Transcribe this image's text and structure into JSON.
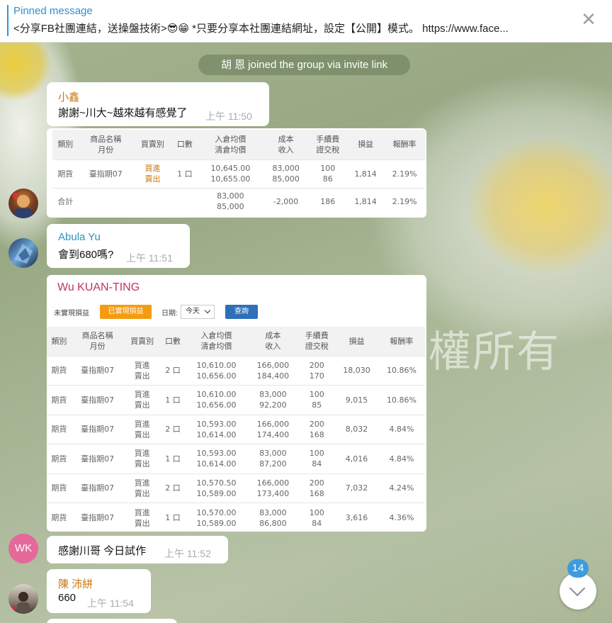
{
  "pinned": {
    "title": "Pinned message",
    "text": "<分享FB社團連結，送操盤技術>😎😁 *只要分享本社團連結網址，設定【公開】模式。 https://www.face...",
    "close_glyph": "✕"
  },
  "watermark": "權所有",
  "service_message": "胡 恩 joined the group via invite link",
  "messages": [
    {
      "sender": "小鑫",
      "text": "謝謝~川大~越來越有感覺了",
      "time": "上午 11:50"
    },
    {
      "sender": "Abula Yu",
      "text": "會到680嗎?",
      "time": "上午 11:51"
    },
    {
      "avatar_initials": "WK",
      "text": "感謝川哥  今日試作",
      "time": "上午 11:52"
    },
    {
      "sender": "陳 沛絣",
      "text": "660",
      "time": "上午 11:54"
    }
  ],
  "table1": {
    "headers": [
      "類別",
      "商品名稱\n月份",
      "買賣別",
      "口數",
      "入倉均價\n清倉均價",
      "成本\n收入",
      "手續費\n證交稅",
      "損益",
      "報酬率"
    ],
    "rows": [
      [
        "期貨",
        "臺指期07",
        "買進\n賣出",
        "1 口",
        "10,645.00\n10,655.00",
        "83,000\n85,000",
        "100\n86",
        "1,814",
        "2.19%"
      ],
      [
        "合計",
        "",
        "",
        "",
        "83,000\n85,000",
        "-2,000",
        "186",
        "1,814",
        "2.19%"
      ]
    ]
  },
  "table2": {
    "sender": "Wu KUAN-TING",
    "filter": {
      "unrealized_label": "未實現損益",
      "realized_button": "已實現損益",
      "date_label": "日期:",
      "date_value": "今天",
      "query_button": "查詢"
    },
    "headers": [
      "類別",
      "商品名稱\n月份",
      "買賣別",
      "口數",
      "入倉均價\n清倉均價",
      "成本\n收入",
      "手續費\n證交稅",
      "損益",
      "報酬率"
    ],
    "rows": [
      [
        "期貨",
        "臺指期07",
        "買進\n賣出",
        "2 口",
        "10,610.00\n10,656.00",
        "166,000\n184,400",
        "200\n170",
        "18,030",
        "10.86%"
      ],
      [
        "期貨",
        "臺指期07",
        "買進\n賣出",
        "1 口",
        "10,610.00\n10,656.00",
        "83,000\n92,200",
        "100\n85",
        "9,015",
        "10.86%"
      ],
      [
        "期貨",
        "臺指期07",
        "買進\n賣出",
        "2 口",
        "10,593.00\n10,614.00",
        "166,000\n174,400",
        "200\n168",
        "8,032",
        "4.84%"
      ],
      [
        "期貨",
        "臺指期07",
        "買進\n賣出",
        "1 口",
        "10,593.00\n10,614.00",
        "83,000\n87,200",
        "100\n84",
        "4,016",
        "4.84%"
      ],
      [
        "期貨",
        "臺指期07",
        "買進\n賣出",
        "2 口",
        "10,570.50\n10,589.00",
        "166,000\n173,400",
        "200\n168",
        "7,032",
        "4.24%"
      ],
      [
        "期貨",
        "臺指期07",
        "買進\n賣出",
        "1 口",
        "10,570.00\n10,589.00",
        "83,000\n86,800",
        "100\n84",
        "3,616",
        "4.36%"
      ]
    ]
  },
  "scroll": {
    "unread_count": "14"
  },
  "colors": {
    "accent": "#2f9ad9",
    "name_orange": "#c9770f",
    "name_blue": "#2f8fbf",
    "name_pink": "#c0326a",
    "profit_red": "#d0202e"
  }
}
